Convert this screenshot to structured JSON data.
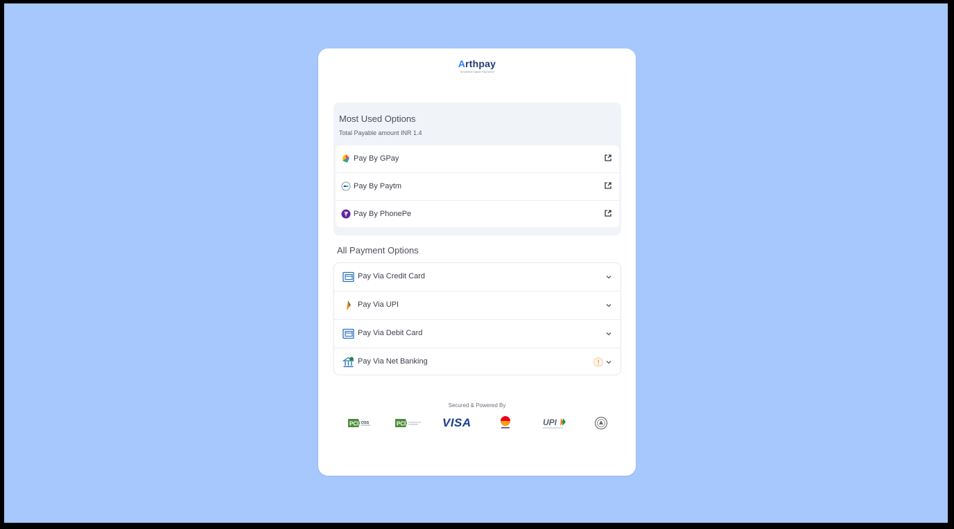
{
  "brand": {
    "name_first": "A",
    "name_rest": "rthpay",
    "tagline": "Simplified Digital Payments"
  },
  "most_used": {
    "title": "Most Used Options",
    "subtitle": "Total Payable amount INR 1.4",
    "items": [
      {
        "label": "Pay By GPay",
        "icon": "gpay-icon"
      },
      {
        "label": "Pay By Paytm",
        "icon": "paytm-icon"
      },
      {
        "label": "Pay By PhonePe",
        "icon": "phonepe-icon"
      }
    ]
  },
  "all_options": {
    "title": "All Payment Options",
    "items": [
      {
        "label": "Pay Via Credit Card",
        "icon": "credit-card-icon"
      },
      {
        "label": "Pay Via UPI",
        "icon": "upi-icon"
      },
      {
        "label": "Pay Via Debit Card",
        "icon": "debit-card-icon"
      },
      {
        "label": "Pay Via Net Banking",
        "icon": "bank-icon"
      }
    ]
  },
  "footer": {
    "secured_text": "Secured & Powered By",
    "visa_text": "VISA",
    "upi_text": "UPI",
    "pci_text": "PCI",
    "dss_text": "DSS"
  },
  "colors": {
    "background": "#a6c8fd",
    "card": "#ffffff",
    "panel": "#f0f3f8",
    "brand_blue": "#2d7cf6",
    "brand_dark": "#1e3a6f"
  }
}
